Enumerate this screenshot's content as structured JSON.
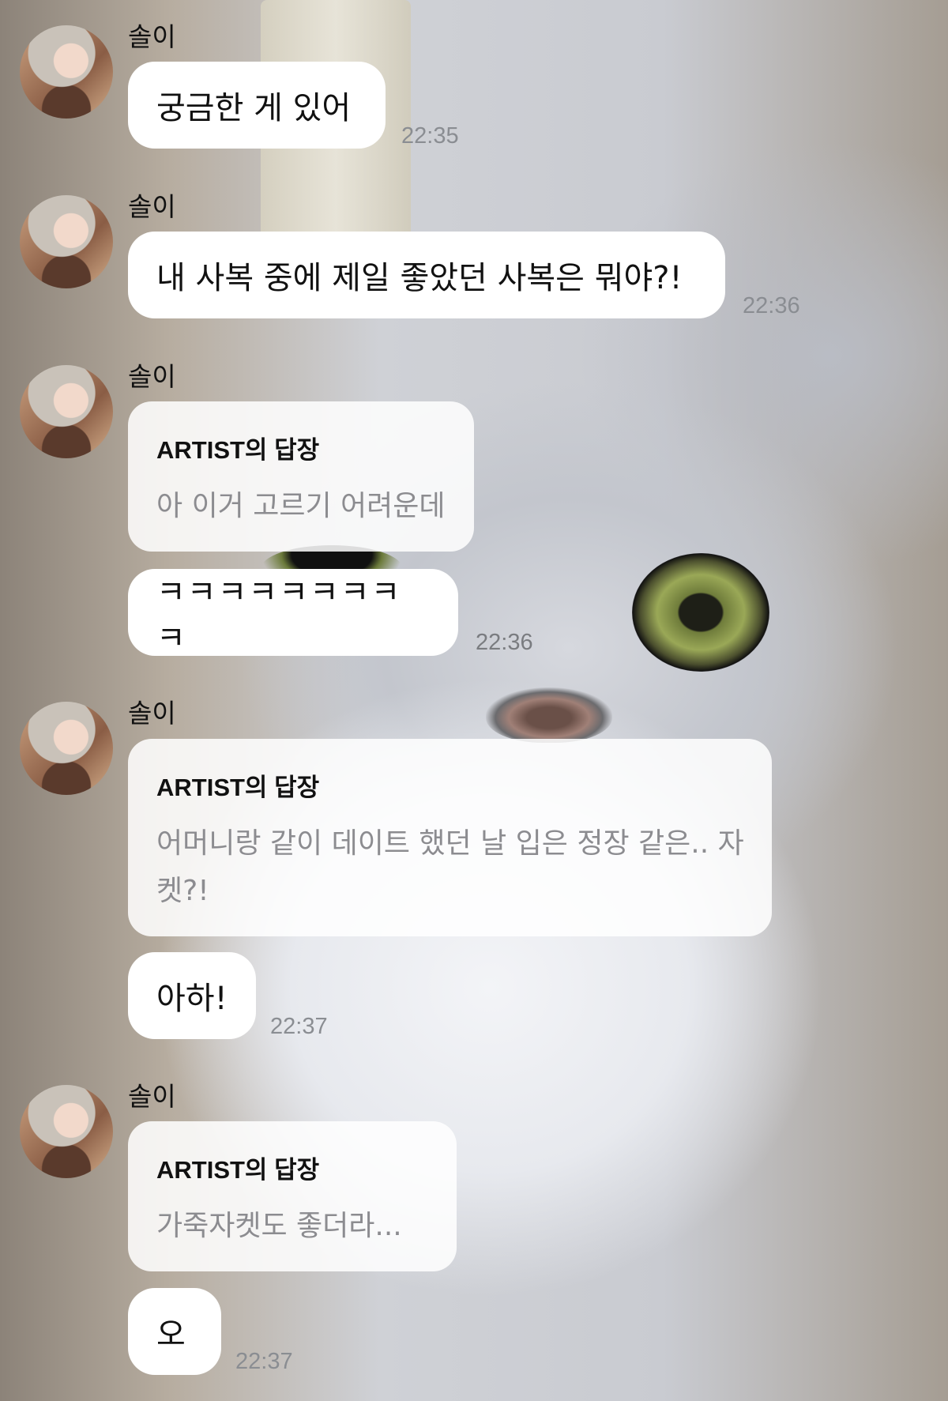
{
  "sender_name": "솔이",
  "messages": [
    {
      "type": "text",
      "text": "궁금한 게 있어",
      "time": "22:35"
    },
    {
      "type": "text",
      "text": "내 사복 중에 제일 좋았던 사복은 뭐야?!",
      "time": "22:36"
    },
    {
      "type": "reply",
      "reply_title": "ARTIST의 답장",
      "reply_text": "아 이거 고르기 어려운데"
    },
    {
      "type": "text",
      "text": "ㅋㅋㅋㅋㅋㅋㅋㅋㅋ",
      "time": "22:36"
    },
    {
      "type": "reply",
      "reply_title": "ARTIST의 답장",
      "reply_text": "어머니랑 같이 데이트 했던 날 입은 정장 같은.. 자켓?!"
    },
    {
      "type": "text",
      "text": "아하!",
      "time": "22:37"
    },
    {
      "type": "reply",
      "reply_title": "ARTIST의 답장",
      "reply_text": "가죽자켓도 좋더라..."
    },
    {
      "type": "text",
      "text": "오",
      "time": "22:37"
    }
  ]
}
